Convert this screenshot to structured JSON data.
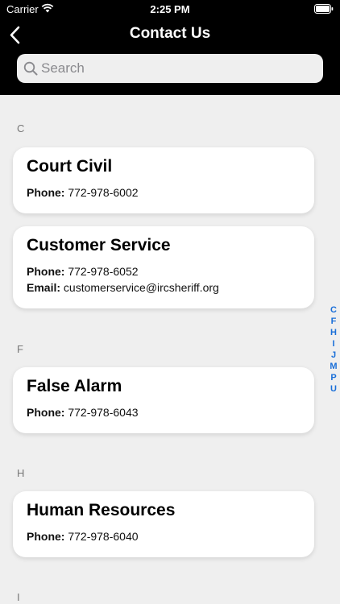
{
  "status_bar": {
    "carrier": "Carrier",
    "time": "2:25 PM"
  },
  "nav": {
    "title": "Contact Us",
    "back_icon": "chevron-left-icon"
  },
  "search": {
    "placeholder": "Search",
    "value": ""
  },
  "sections": [
    {
      "letter": "C",
      "contacts": [
        {
          "name": "Court Civil",
          "phone_label": "Phone:",
          "phone": "772-978-6002"
        },
        {
          "name": "Customer Service",
          "phone_label": "Phone:",
          "phone": "772-978-6052",
          "email_label": "Email:",
          "email": "customerservice@ircsheriff.org"
        }
      ]
    },
    {
      "letter": "F",
      "contacts": [
        {
          "name": "False Alarm",
          "phone_label": "Phone:",
          "phone": "772-978-6043"
        }
      ]
    },
    {
      "letter": "H",
      "contacts": [
        {
          "name": "Human Resources",
          "phone_label": "Phone:",
          "phone": "772-978-6040"
        }
      ]
    },
    {
      "letter": "I",
      "contacts": []
    }
  ],
  "index_letters": [
    "C",
    "F",
    "H",
    "I",
    "J",
    "M",
    "P",
    "U"
  ],
  "colors": {
    "header_bg": "#000000",
    "index_accent": "#1a6fd8",
    "list_bg": "#efefef"
  }
}
